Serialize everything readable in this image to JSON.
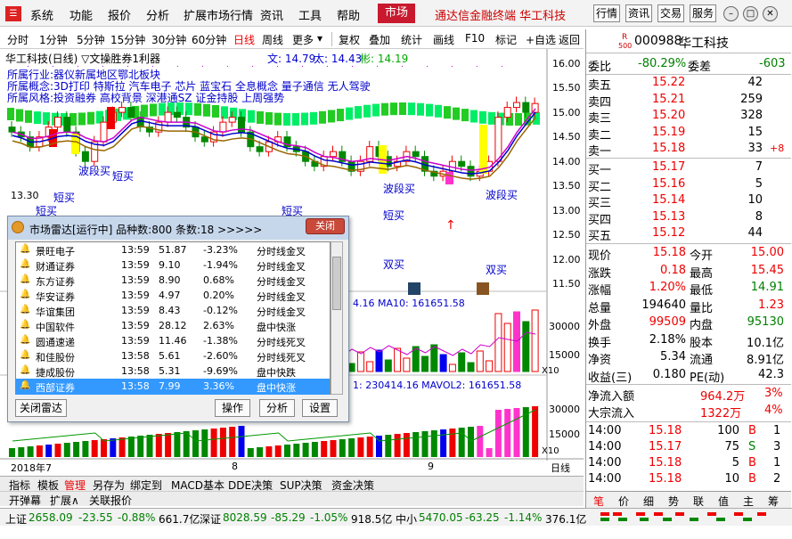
{
  "menu": {
    "items": [
      "系统",
      "功能",
      "报价",
      "分析",
      "扩展市场行情",
      "资讯",
      "工具",
      "帮助"
    ],
    "market": "市场",
    "brand": "通达信金融终端 华工科技",
    "buttons": [
      "行情",
      "资讯",
      "交易",
      "服务"
    ]
  },
  "toolbar": {
    "items": [
      "分时",
      "1分钟",
      "5分钟",
      "15分钟",
      "30分钟",
      "60分钟",
      "日线",
      "周线",
      "更多",
      "复权",
      "叠加",
      "统计",
      "画线",
      "F10",
      "标记",
      "+自选",
      "返回"
    ]
  },
  "chart": {
    "title": "华工科技(日线) ▽文操胜券1利器",
    "ma": {
      "wen": "文: 14.79",
      "tai": "太: 14.43",
      "bin": "彬: 14.19"
    },
    "sector_lines": [
      "所属行业:器仪新属地区鄂北板块",
      "所属概念:3D打印 特斯拉 汽车电子 芯片 蓝宝石 全息概念 量子通信 无人驾驶",
      "所属风格:投资融券 高校背景 深港通SZ 证金持股 上周强势"
    ],
    "right_axis": [
      "16.00",
      "15.50",
      "15.00",
      "14.50",
      "14.00",
      "13.50",
      "13.00",
      "12.50",
      "12.00",
      "11.50"
    ],
    "low_label": "13.30",
    "annotations": [
      {
        "t": "短买",
        "l": 58,
        "tp": 158
      },
      {
        "t": "波段买",
        "l": 90,
        "tp": 130
      },
      {
        "t": "短买",
        "l": 128,
        "tp": 135
      },
      {
        "t": "短买",
        "l": 40,
        "tp": 175
      },
      {
        "t": "短买",
        "l": 315,
        "tp": 175
      },
      {
        "t": "波段买",
        "l": 430,
        "tp": 148
      },
      {
        "t": "短买",
        "l": 430,
        "tp": 180
      },
      {
        "t": "波段买",
        "l": 545,
        "tp": 155
      },
      {
        "t": "双买",
        "l": 430,
        "tp": 233
      },
      {
        "t": "双买",
        "l": 545,
        "tp": 240
      }
    ],
    "vol_ma": "4.16 MA10: 161651.58",
    "vol2_ma": "1: 230414.16  MAVOL2: 161651.58",
    "vol_axis": [
      "30000",
      "15000"
    ],
    "vol2_axis": [
      "30000",
      "15000"
    ],
    "x10": "X10",
    "dates": [
      "2018年7",
      "8",
      "9"
    ],
    "period": "日线"
  },
  "radar": {
    "title": "市场雷达[运行中] 品种数:800 条数:18  >>>>>",
    "close": "关闭",
    "rows": [
      [
        "景旺电子",
        "13:59",
        "51.87",
        "-3.23%",
        "分时线金叉"
      ],
      [
        "财通证券",
        "13:59",
        "9.10",
        "-1.94%",
        "分时线金叉"
      ],
      [
        "东方证券",
        "13:59",
        "8.90",
        "0.68%",
        "分时线金叉"
      ],
      [
        "华安证券",
        "13:59",
        "4.97",
        "0.20%",
        "分时线金叉"
      ],
      [
        "华谊集团",
        "13:59",
        "8.43",
        "-0.12%",
        "分时线金叉"
      ],
      [
        "中国软件",
        "13:59",
        "28.12",
        "2.63%",
        "盘中快涨"
      ],
      [
        "圆通速递",
        "13:59",
        "11.46",
        "-1.38%",
        "分时线死叉"
      ],
      [
        "和佳股份",
        "13:58",
        "5.61",
        "-2.60%",
        "分时线死叉"
      ],
      [
        "捷成股份",
        "13:58",
        "5.31",
        "-9.69%",
        "盘中快跌"
      ],
      [
        "西部证券",
        "13:58",
        "7.99",
        "3.36%",
        "盘中快涨"
      ]
    ],
    "buttons": [
      "关闭雷达",
      "操作",
      "分析",
      "设置"
    ]
  },
  "bottom_tabs": [
    "指标",
    "模板",
    "管理",
    "另存为",
    "绑定到",
    "MACD基本",
    "DDE决策",
    "SUP决策",
    "资金决策"
  ],
  "bottom_tabs2": [
    "开弹幕",
    "扩展∧",
    "关联报价"
  ],
  "status": {
    "sh_label": "上证",
    "sh_val": "2658.09",
    "sh_chg": "-23.55",
    "sh_pct": "-0.88%",
    "sh_amt": "661.7亿",
    "sz_label": "深证",
    "sz_val": "8028.59",
    "sz_chg": "-85.29",
    "sz_pct": "-1.05%",
    "sz_amt": "918.5亿",
    "zx_label": "中小",
    "zx_val": "5470.05",
    "zx_chg": "-63.25",
    "zx_pct": "-1.14%",
    "zx_amt": "376.1亿"
  },
  "quote": {
    "code": "000988",
    "name": "华工科技",
    "r": "R",
    "r500": "500",
    "weibi_label": "委比",
    "weibi": "-80.29%",
    "weicha_label": "委差",
    "weicha": "-603",
    "asks": [
      [
        "卖五",
        "15.22",
        "42"
      ],
      [
        "卖四",
        "15.21",
        "259"
      ],
      [
        "卖三",
        "15.20",
        "328"
      ],
      [
        "卖二",
        "15.19",
        "15"
      ],
      [
        "卖一",
        "15.18",
        "33",
        "+8"
      ]
    ],
    "bids": [
      [
        "买一",
        "15.17",
        "7"
      ],
      [
        "买二",
        "15.16",
        "5"
      ],
      [
        "买三",
        "15.14",
        "10"
      ],
      [
        "买四",
        "15.13",
        "8"
      ],
      [
        "买五",
        "15.12",
        "44"
      ]
    ],
    "stats": [
      [
        "现价",
        "15.18",
        "今开",
        "15.00"
      ],
      [
        "涨跌",
        "0.18",
        "最高",
        "15.45"
      ],
      [
        "涨幅",
        "1.20%",
        "最低",
        "14.91"
      ],
      [
        "总量",
        "194640",
        "量比",
        "1.23"
      ],
      [
        "外盘",
        "99509",
        "内盘",
        "95130"
      ],
      [
        "换手",
        "2.18%",
        "股本",
        "10.1亿"
      ],
      [
        "净资",
        "5.34",
        "流通",
        "8.91亿"
      ],
      [
        "收益(三)",
        "0.180",
        "PE(动)",
        "42.3"
      ]
    ],
    "flow": [
      [
        "净流入额",
        "964.2万",
        "3%"
      ],
      [
        "大宗流入",
        "1322万",
        "4%"
      ]
    ],
    "ticks": [
      [
        "14:00",
        "15.18",
        "100",
        "B",
        "1"
      ],
      [
        "14:00",
        "15.17",
        "75",
        "S",
        "3"
      ],
      [
        "14:00",
        "15.18",
        "5",
        "B",
        "1"
      ],
      [
        "14:00",
        "15.18",
        "10",
        "B",
        "2"
      ]
    ],
    "tabs": [
      "笔",
      "价",
      "细",
      "势",
      "联",
      "值",
      "主",
      "筹"
    ]
  },
  "colors": {
    "up": "#e00000",
    "down": "#008000",
    "accent": "#c8192e"
  }
}
